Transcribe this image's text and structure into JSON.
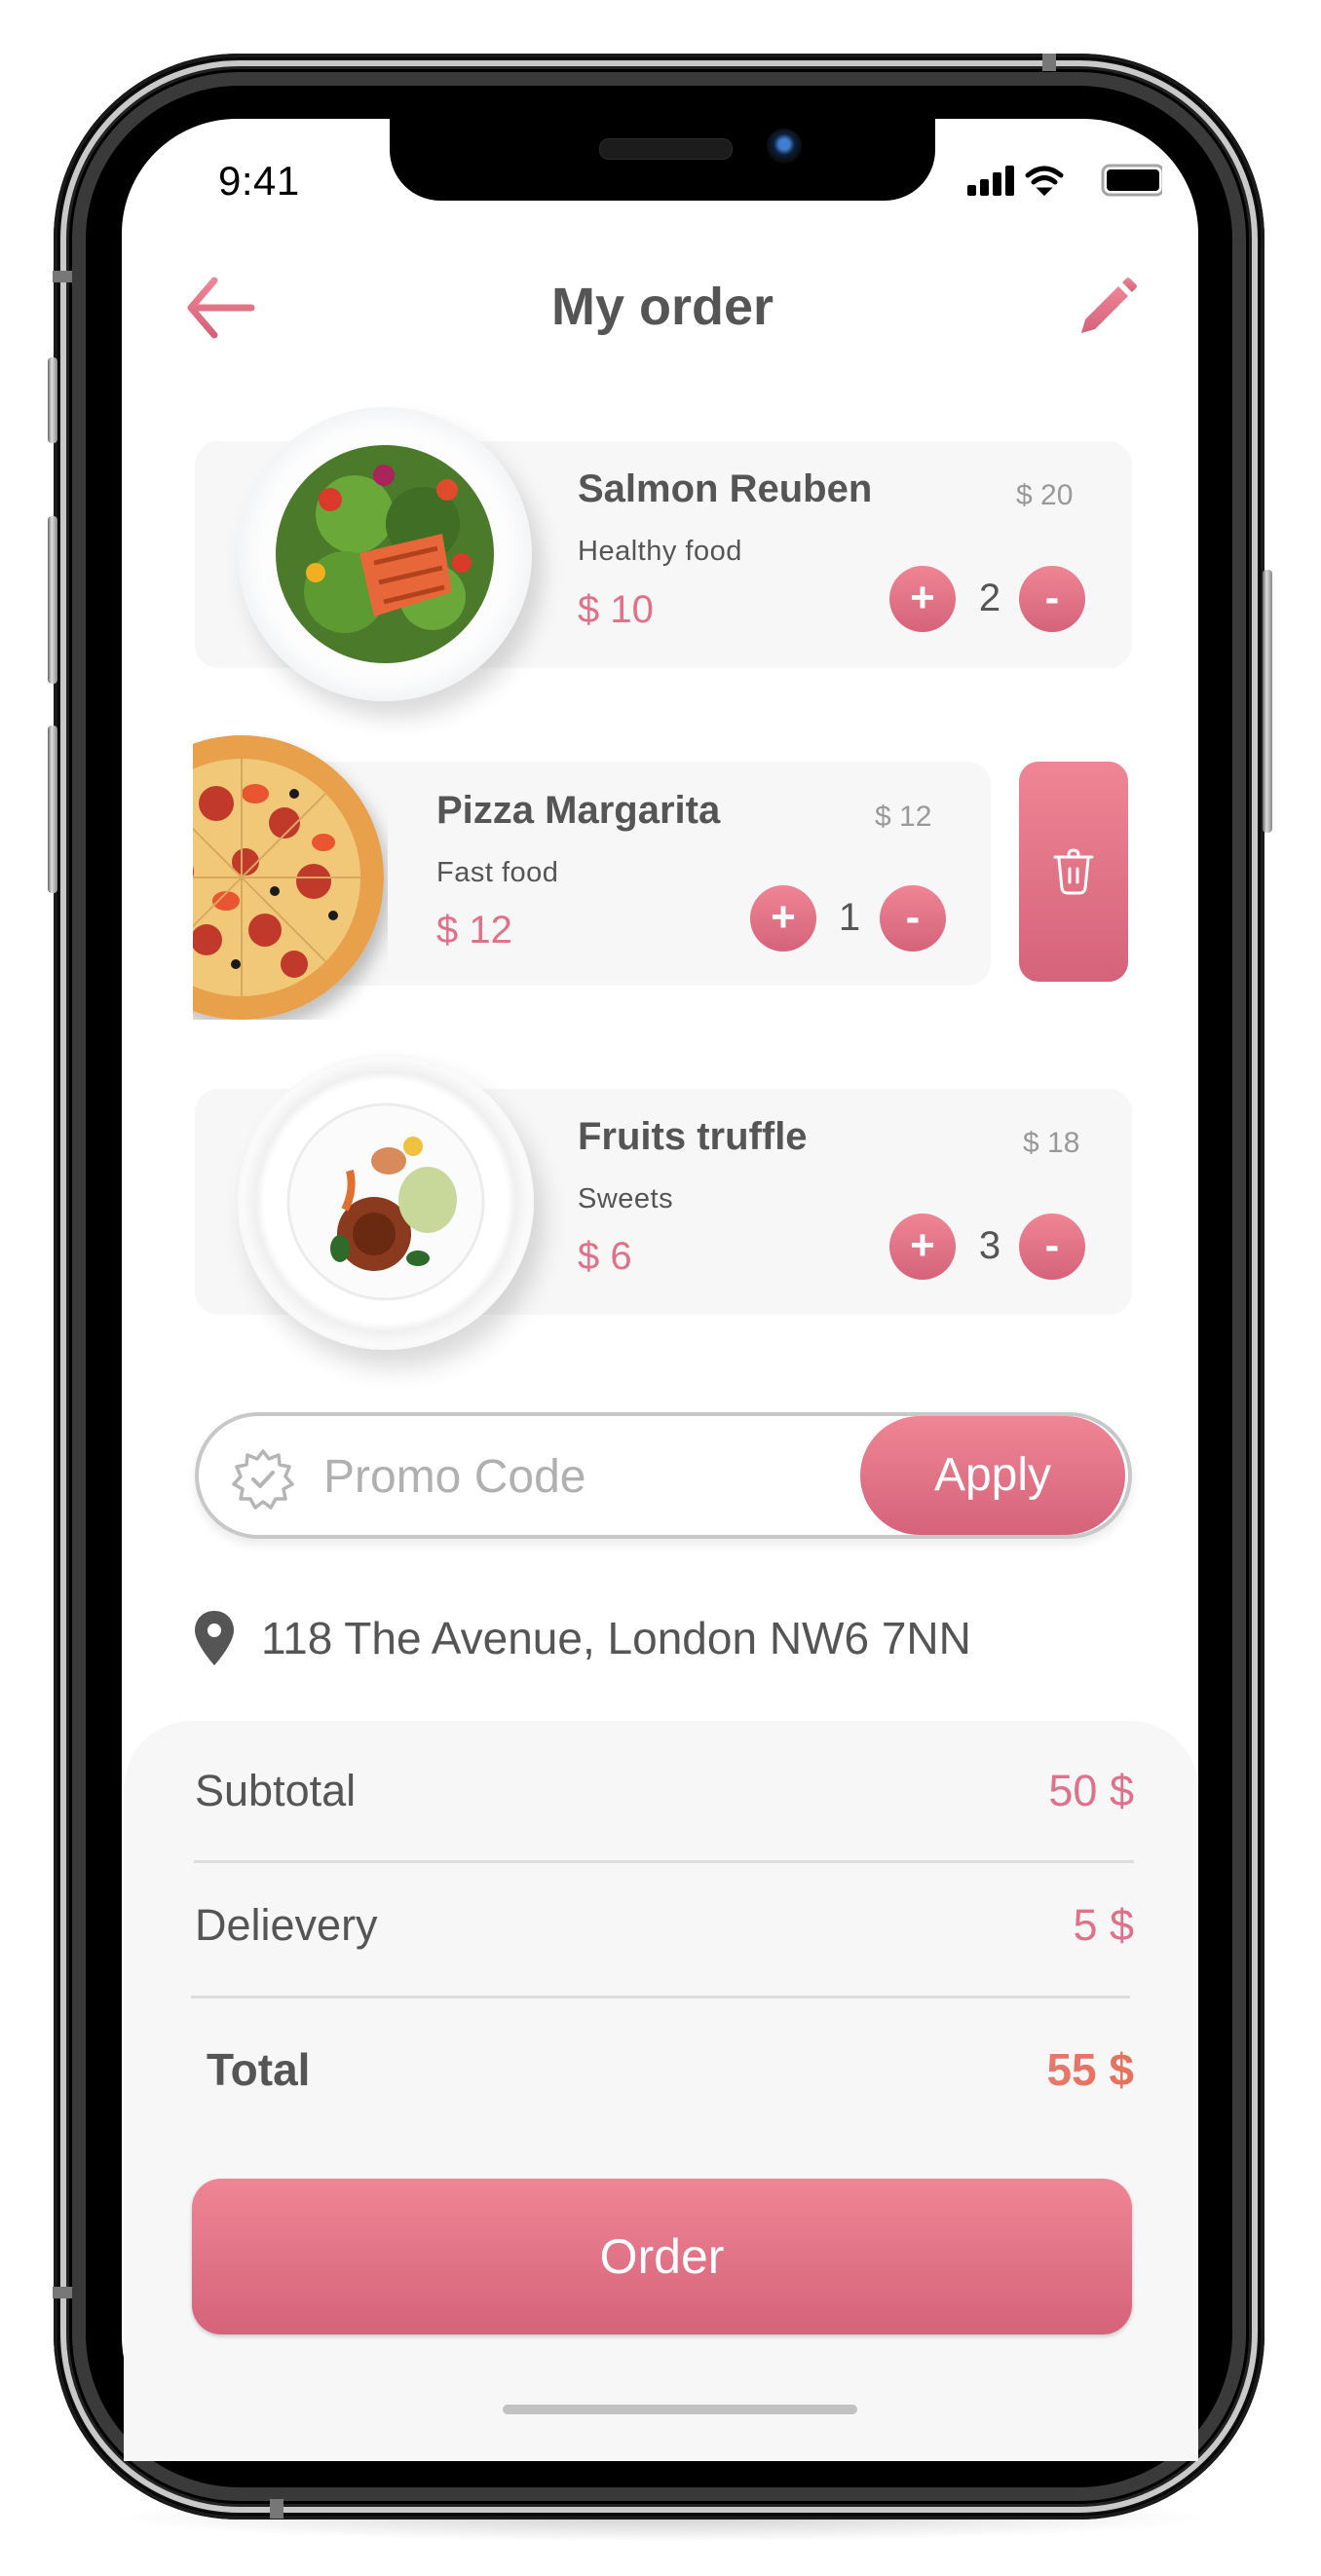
{
  "status_bar": {
    "time": "9:41",
    "icons": [
      "signal-icon",
      "wifi-icon",
      "battery-icon"
    ]
  },
  "header": {
    "title": "My order",
    "back_icon": "arrow-left-icon",
    "edit_icon": "pencil-icon"
  },
  "theme": {
    "accent": "#e0718a",
    "accent_gradient_top": "#ef8595",
    "accent_gradient_bottom": "#d5637a",
    "text": "#555555",
    "muted": "#999999",
    "card_bg": "#f7f7f7"
  },
  "items": [
    {
      "name": "Salmon Reuben",
      "category": "Healthy food",
      "price": "$ 10",
      "original_price": "$ 20",
      "quantity": "2",
      "image": "salmon-salad-plate",
      "plus": "+",
      "minus": "-"
    },
    {
      "name": "Pizza Margarita",
      "category": "Fast food",
      "price": "$ 12",
      "original_price": "$ 12",
      "quantity": "1",
      "image": "pizza",
      "plus": "+",
      "minus": "-",
      "swiped": true,
      "delete_icon": "trash-icon"
    },
    {
      "name": "Fruits truffle",
      "category": "Sweets",
      "price": "$ 6",
      "original_price": "$ 18",
      "quantity": "3",
      "image": "dessert-plate",
      "plus": "+",
      "minus": "-"
    }
  ],
  "promo": {
    "placeholder": "Promo Code",
    "value": "",
    "icon": "badge-check-icon",
    "apply_label": "Apply"
  },
  "address": {
    "icon": "map-pin-icon",
    "text": "118 The Avenue, London NW6 7NN"
  },
  "summary": {
    "subtotal_label": "Subtotal",
    "subtotal_value": "50 $",
    "delivery_label": "Delievery",
    "delivery_value": "5 $",
    "total_label": "Total",
    "total_value": "55 $"
  },
  "order_button": {
    "label": "Order"
  }
}
